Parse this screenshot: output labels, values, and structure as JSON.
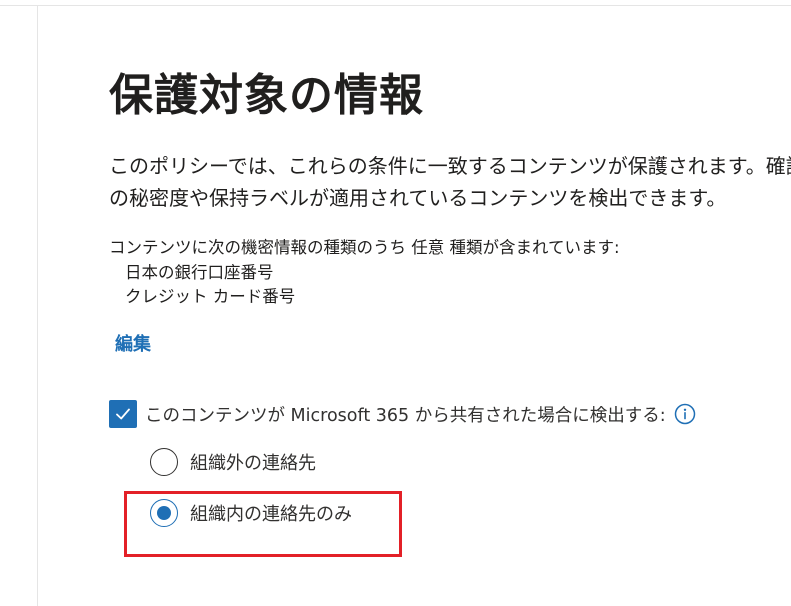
{
  "page": {
    "title": "保護対象の情報",
    "intro_lines": [
      "このポリシーでは、これらの条件に一致するコンテンツが保護されます。確認",
      "の秘密度や保持ラベルが適用されているコンテンツを検出できます。"
    ]
  },
  "criteria": {
    "heading": "コンテンツに次の機密情報の種類のうち 任意 種類が含まれています:",
    "items": [
      "日本の銀行口座番号",
      "クレジット カード番号"
    ]
  },
  "edit_link": "編集",
  "detect_share": {
    "label": "このコンテンツが Microsoft 365 から共有された場合に検出する:",
    "checked": true,
    "info_icon": "info-circle-icon"
  },
  "scope_options": [
    {
      "label": "組織外の連絡先",
      "selected": false
    },
    {
      "label": "組織内の連絡先のみ",
      "selected": true
    }
  ],
  "colors": {
    "accent": "#1f6fb5",
    "highlight": "#e32027"
  }
}
